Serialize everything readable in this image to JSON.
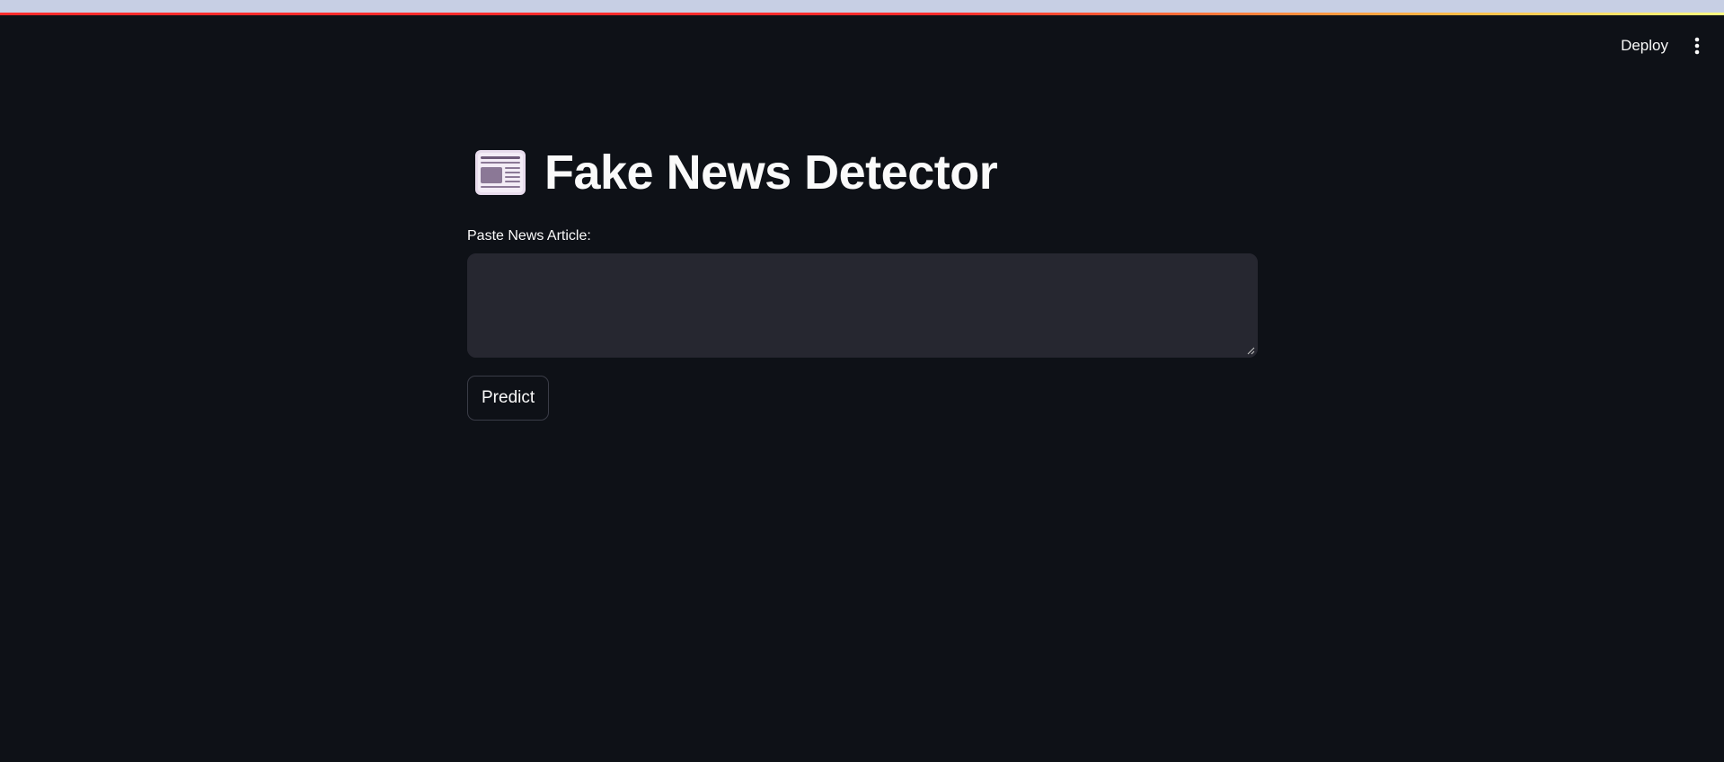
{
  "app": {
    "title": "Fake News Detector",
    "title_icon": "newspaper-icon"
  },
  "header": {
    "deploy_label": "Deploy",
    "menu_icon": "vertical-ellipsis-icon"
  },
  "form": {
    "article_label": "Paste News Article:",
    "article_value": "",
    "article_placeholder": "",
    "predict_label": "Predict"
  },
  "colors": {
    "background": "#0e1117",
    "input_background": "#262730",
    "text": "#fafafa",
    "decoration_red": "#ff2b2b",
    "decoration_yellow": "#fffd80"
  }
}
